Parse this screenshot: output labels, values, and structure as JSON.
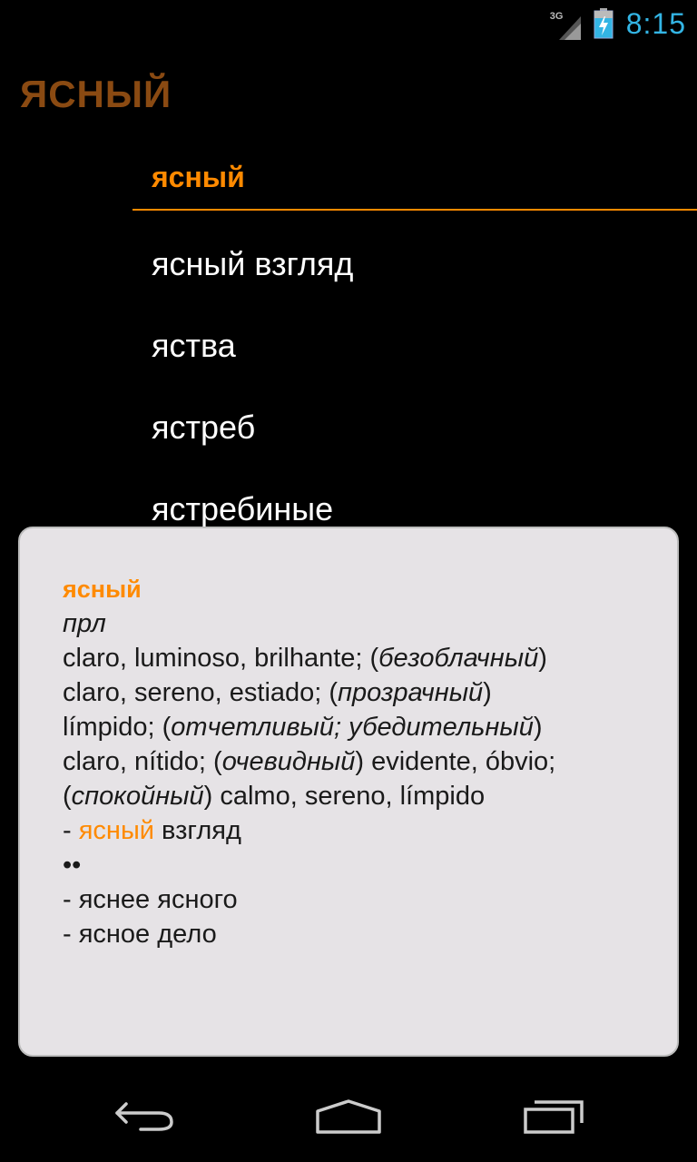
{
  "status_bar": {
    "network": "3G",
    "time": "8:15",
    "accent_color": "#33b5e5",
    "icons": [
      "signal-icon",
      "battery-charging-icon"
    ]
  },
  "header": {
    "title": "ЯСНЫЙ"
  },
  "word_list": {
    "items": [
      "ясный",
      "ясный взгляд",
      "яства",
      "ястреб",
      "ястребиные"
    ],
    "selected_index": 0,
    "accent_color": "#ff8a00"
  },
  "definition": {
    "headword": "ясный",
    "part_of_speech": "прл",
    "lines": [
      [
        {
          "t": "claro, luminoso, brilhante; ("
        },
        {
          "t": "безоблачный",
          "style": "italic"
        },
        {
          "t": ")"
        }
      ],
      [
        {
          "t": "claro, sereno, estiado; ("
        },
        {
          "t": "прозрачный",
          "style": "italic"
        },
        {
          "t": ")"
        }
      ],
      [
        {
          "t": "límpido; ("
        },
        {
          "t": "отчетливый; убедительный",
          "style": "italic"
        },
        {
          "t": ")"
        }
      ],
      [
        {
          "t": "claro, nítido; ("
        },
        {
          "t": "очевидный",
          "style": "italic"
        },
        {
          "t": ") evidente, óbvio;"
        }
      ],
      [
        {
          "t": "("
        },
        {
          "t": "спокойный",
          "style": "italic"
        },
        {
          "t": ") calmo, sereno, límpido"
        }
      ],
      [
        {
          "t": "- "
        },
        {
          "t": "ясный",
          "style": "highlight"
        },
        {
          "t": " взгляд"
        }
      ],
      [
        {
          "t": "••"
        }
      ],
      [
        {
          "t": "- яснее ясного"
        }
      ],
      [
        {
          "t": "- ясное дело"
        }
      ]
    ]
  },
  "nav_bar": {
    "icons": [
      "back-icon",
      "home-icon",
      "recent-apps-icon"
    ]
  }
}
